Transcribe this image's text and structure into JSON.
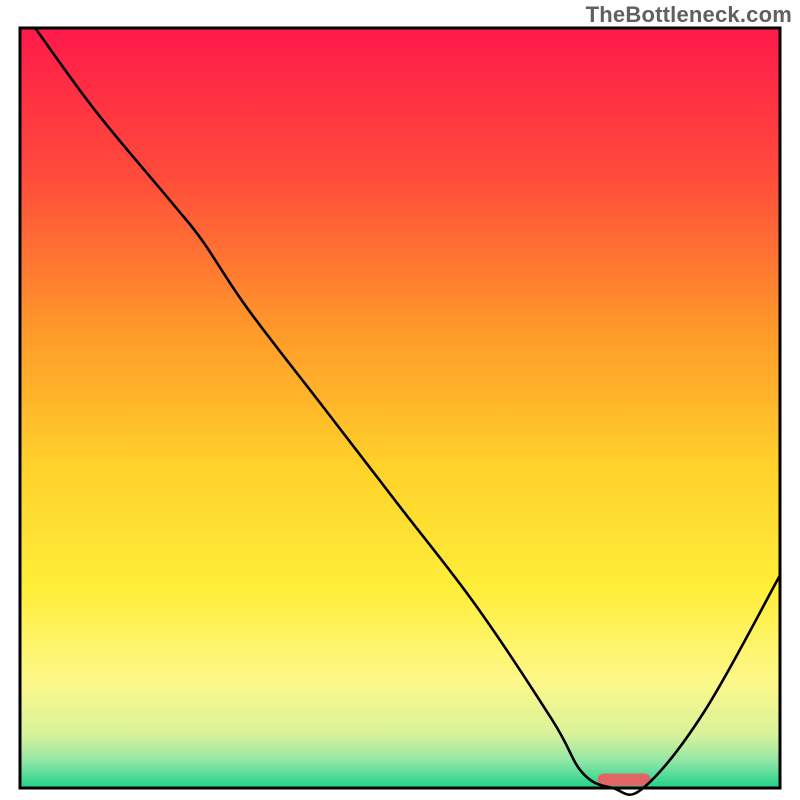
{
  "watermark": "TheBottleneck.com",
  "chart_data": {
    "type": "line",
    "title": "",
    "xlabel": "",
    "ylabel": "",
    "xlim": [
      0,
      100
    ],
    "ylim": [
      0,
      100
    ],
    "grid": false,
    "legend": false,
    "background_gradient_stops": [
      {
        "offset": 0.0,
        "color": "#ff1a4b"
      },
      {
        "offset": 0.2,
        "color": "#ff4d3a"
      },
      {
        "offset": 0.4,
        "color": "#ff9a2a"
      },
      {
        "offset": 0.58,
        "color": "#ffd22a"
      },
      {
        "offset": 0.74,
        "color": "#ffee3a"
      },
      {
        "offset": 0.86,
        "color": "#fdf88a"
      },
      {
        "offset": 0.93,
        "color": "#d8f29a"
      },
      {
        "offset": 0.965,
        "color": "#8fe6a6"
      },
      {
        "offset": 1.0,
        "color": "#1fd28a"
      }
    ],
    "series": [
      {
        "name": "bottleneck-curve",
        "color": "#000000",
        "x": [
          2,
          10,
          20,
          24,
          30,
          40,
          50,
          60,
          70,
          74,
          78,
          82,
          90,
          100
        ],
        "y": [
          100,
          89,
          77,
          72,
          63,
          50,
          37,
          24,
          9,
          2,
          0,
          0,
          10,
          28
        ]
      }
    ],
    "markers": [
      {
        "name": "optimal-range-marker",
        "shape": "rounded-rect",
        "color": "#e06666",
        "x_start": 76,
        "x_end": 83,
        "y": 0.3,
        "height": 1.6
      }
    ],
    "plot_frame": {
      "stroke": "#000000",
      "stroke_width": 3
    }
  }
}
